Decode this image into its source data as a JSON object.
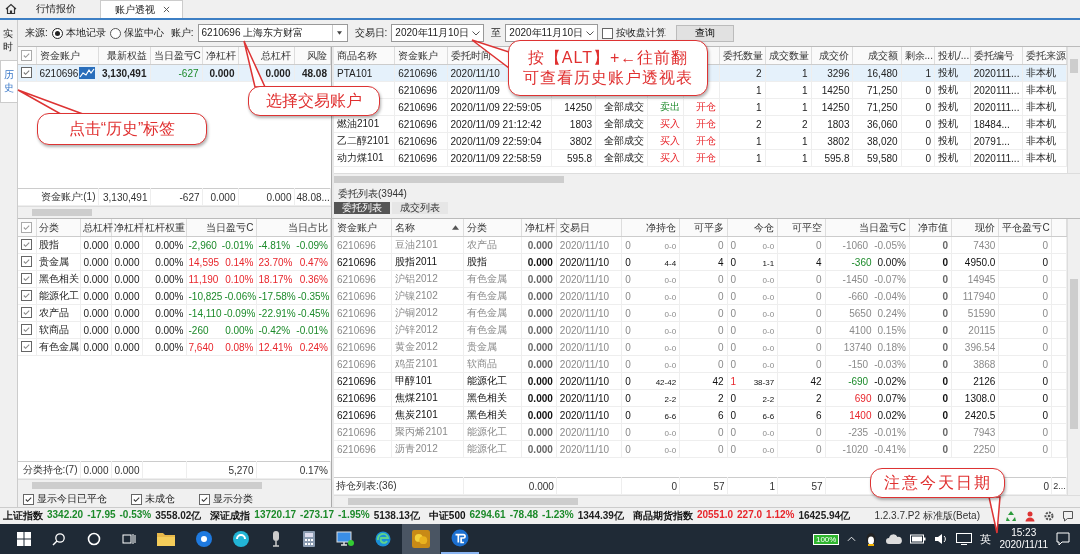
{
  "top_tabs": [
    {
      "label": "行情报价",
      "selected": false,
      "closable": false
    },
    {
      "label": "账户透视",
      "selected": true,
      "closable": true
    }
  ],
  "side_tabs": [
    {
      "label": "实时",
      "selected": false
    },
    {
      "label": "历史",
      "selected": true
    }
  ],
  "filter": {
    "source_label": "来源:",
    "sources": [
      {
        "label": "本地记录",
        "selected": true
      },
      {
        "label": "保监中心",
        "selected": false
      }
    ],
    "account_label": "账户:",
    "account": "6210696 上海东方财富",
    "date_label": "交易日:",
    "date_from": "2020年11月10日",
    "to_label": "至",
    "date_to": "2020年11月10日",
    "close_calc": {
      "label": "按收盘计算",
      "checked": false
    },
    "query_button": "查询"
  },
  "accounts": {
    "header_checked": true,
    "columns": [
      "资金账户",
      "最新权益",
      "当日盈亏C",
      "净杠杆",
      "总杠杆",
      "风险"
    ],
    "rows": [
      {
        "checked": true,
        "selected": true,
        "rising": false,
        "cells": [
          "6210696",
          "3,130,491",
          "-627",
          "0.000",
          "0.000",
          "48.08"
        ]
      }
    ],
    "footer": [
      "资金账户:(1)",
      "3,130,491",
      "-627",
      "0.000",
      "0.000",
      "48.08..."
    ]
  },
  "orders": {
    "columns": [
      "商品名称",
      "资金账户",
      "委托时间",
      null,
      null,
      null,
      null,
      "委托数量",
      "成交数量",
      "成交价",
      "成交额",
      "剩余...",
      "投机/...",
      "委托编号",
      "委托来源"
    ],
    "rows": [
      {
        "selected": true,
        "cells": [
          "PTA101",
          "6210696",
          "2020/11/10",
          null,
          null,
          null,
          null,
          "2",
          "1",
          "3296",
          "16,480",
          "1",
          "投机",
          "2020111...",
          "非本机"
        ]
      },
      {
        "selected": false,
        "cells": [
          null,
          "6210696",
          "2020/11/09",
          null,
          null,
          null,
          null,
          "1",
          "1",
          "14250",
          "71,250",
          "0",
          "投机",
          "2020111...",
          "非本机"
        ]
      },
      {
        "selected": false,
        "sell": true,
        "cells": [
          null,
          "6210696",
          "2020/11/09 22:59:05",
          "14250",
          "全部成交",
          "卖出",
          "开仓",
          "1",
          "1",
          "14250",
          "71,250",
          "0",
          "投机",
          "2020111...",
          "非本机"
        ]
      },
      {
        "selected": false,
        "sell": false,
        "cells": [
          "燃油2101",
          "6210696",
          "2020/11/09 21:12:42",
          "1803",
          "全部成交",
          "买入",
          "开仓",
          "2",
          "2",
          "1803",
          "36,060",
          "0",
          "投机",
          "18484...",
          "非本机"
        ]
      },
      {
        "selected": false,
        "sell": false,
        "cells": [
          "乙二醇2101",
          "6210696",
          "2020/11/09 22:59:04",
          "3802",
          "全部成交",
          "买入",
          "开仓",
          "1",
          "1",
          "3802",
          "38,020",
          "0",
          "投机",
          "20791...",
          "非本机"
        ]
      },
      {
        "selected": false,
        "sell": false,
        "cells": [
          "动力煤101",
          "6210696",
          "2020/11/09 22:58:59",
          "595.8",
          "全部成交",
          "买入",
          "开仓",
          "1",
          "1",
          "595.8",
          "59,580",
          "0",
          "投机",
          "2020111...",
          "非本机"
        ]
      }
    ],
    "list_label": "委托列表(3944)",
    "sub_tabs": [
      {
        "label": "委托列表",
        "selected": true
      },
      {
        "label": "成交列表",
        "selected": false
      }
    ]
  },
  "categories": {
    "header_checked": true,
    "columns": [
      "分类",
      "总杠杆",
      "净杠杆",
      "杠杆权重",
      "当日盈亏C",
      "当日占比"
    ],
    "rows": [
      {
        "checked": true,
        "rising": false,
        "name": "股指",
        "total": "0.000",
        "net": "0.000",
        "weight": "0.00%",
        "pnl": "-2,960",
        "pnl_pct": "-0.01%",
        "share": "-4.81%",
        "share_pct": "-0.09%"
      },
      {
        "checked": true,
        "rising": true,
        "name": "贵金属",
        "total": "0.000",
        "net": "0.000",
        "weight": "0.00%",
        "pnl": "14,595",
        "pnl_pct": "0.14%",
        "share": "23.70%",
        "share_pct": "0.47%"
      },
      {
        "checked": true,
        "rising": true,
        "name": "黑色相关",
        "total": "0.000",
        "net": "0.000",
        "weight": "0.00%",
        "pnl": "11,190",
        "pnl_pct": "0.10%",
        "share": "18.17%",
        "share_pct": "0.36%"
      },
      {
        "checked": true,
        "rising": false,
        "name": "能源化工",
        "total": "0.000",
        "net": "0.000",
        "weight": "0.00%",
        "pnl": "-10,825",
        "pnl_pct": "-0.06%",
        "share": "-17.58%",
        "share_pct": "-0.35%"
      },
      {
        "checked": true,
        "rising": false,
        "name": "农产品",
        "total": "0.000",
        "net": "0.000",
        "weight": "0.00%",
        "pnl": "-14,110",
        "pnl_pct": "-0.09%",
        "share": "-22.91%",
        "share_pct": "-0.45%"
      },
      {
        "checked": true,
        "rising": false,
        "name": "软商品",
        "total": "0.000",
        "net": "0.000",
        "weight": "0.00%",
        "pnl": "-260",
        "pnl_pct": "0.00%",
        "share": "-0.42%",
        "share_pct": "-0.01%"
      },
      {
        "checked": true,
        "rising": true,
        "name": "有色金属",
        "total": "0.000",
        "net": "0.000",
        "weight": "0.00%",
        "pnl": "7,640",
        "pnl_pct": "0.08%",
        "share": "12.41%",
        "share_pct": "0.24%"
      }
    ],
    "footer": {
      "label": "分类持仓:(7)",
      "total": "0.000",
      "net": "0.000",
      "pnl": "5,270",
      "share": "0.17%"
    },
    "options": [
      {
        "label": "显示今日已平仓",
        "checked": true
      },
      {
        "label": "未成仓",
        "checked": true
      },
      {
        "label": "显示分类",
        "checked": true
      }
    ]
  },
  "positions": {
    "columns": [
      {
        "label": "资金账户",
        "sorted": false
      },
      {
        "label": "名称",
        "sorted": true
      },
      {
        "label": "分类",
        "sorted": false
      },
      {
        "label": "净杠杆",
        "sorted": false
      },
      {
        "label": "交易日",
        "sorted": false
      },
      {
        "label": "净持仓",
        "sorted": false
      },
      {
        "label": "可平多",
        "sorted": false
      },
      {
        "label": "今仓",
        "sorted": false
      },
      {
        "label": "可平空",
        "sorted": false
      },
      {
        "label": "当日盈亏C",
        "sorted": false
      },
      {
        "label": "净市值",
        "sorted": false
      },
      {
        "label": "现价",
        "sorted": false
      },
      {
        "label": "平仓盈亏C",
        "sorted": false
      }
    ],
    "rows": [
      {
        "active": false,
        "account": "6210696",
        "name": "豆油2101",
        "category": "农产品",
        "lev": "0.000",
        "date": "2020/11/10",
        "net": [
          "0",
          "0-0"
        ],
        "long": "0",
        "today": [
          "0",
          "0-0"
        ],
        "short": "0",
        "pnl": [
          "-1060",
          "-0.05%"
        ],
        "mv": "0",
        "price": "7430",
        "close_pnl": "0"
      },
      {
        "active": true,
        "rising": false,
        "today_rising": false,
        "account": "6210696",
        "name": "股指2011",
        "category": "股指",
        "lev": "0.000",
        "date": "2020/11/10",
        "net": [
          "0",
          "4-4"
        ],
        "long": "4",
        "today": [
          "0",
          "1-1"
        ],
        "short": "4",
        "pnl": [
          "-360",
          "0.00%"
        ],
        "mv": "0",
        "price": "4950.0",
        "close_pnl": "0"
      },
      {
        "active": false,
        "account": "6210696",
        "name": "沪铝2012",
        "category": "有色金属",
        "lev": "0.000",
        "date": "2020/11/10",
        "net": [
          "0",
          "0-0"
        ],
        "long": "0",
        "today": [
          "0",
          "0-0"
        ],
        "short": "0",
        "pnl": [
          "-1450",
          "-0.07%"
        ],
        "mv": "0",
        "price": "14945",
        "close_pnl": "0"
      },
      {
        "active": false,
        "account": "6210696",
        "name": "沪镍2102",
        "category": "有色金属",
        "lev": "0.000",
        "date": "2020/11/10",
        "net": [
          "0",
          "0-0"
        ],
        "long": "0",
        "today": [
          "0",
          "0-0"
        ],
        "short": "0",
        "pnl": [
          "-660",
          "-0.04%"
        ],
        "mv": "0",
        "price": "117940",
        "close_pnl": "0"
      },
      {
        "active": false,
        "account": "6210696",
        "name": "沪铜2012",
        "category": "有色金属",
        "lev": "0.000",
        "date": "2020/11/10",
        "net": [
          "0",
          "0-0"
        ],
        "long": "0",
        "today": [
          "0",
          "0-0"
        ],
        "short": "0",
        "pnl": [
          "5650",
          "0.24%"
        ],
        "mv": "0",
        "price": "51590",
        "close_pnl": "0"
      },
      {
        "active": false,
        "account": "6210696",
        "name": "沪锌2012",
        "category": "有色金属",
        "lev": "0.000",
        "date": "2020/11/10",
        "net": [
          "0",
          "0-0"
        ],
        "long": "0",
        "today": [
          "0",
          "0-0"
        ],
        "short": "0",
        "pnl": [
          "4100",
          "0.15%"
        ],
        "mv": "0",
        "price": "20115",
        "close_pnl": "0"
      },
      {
        "active": false,
        "account": "6210696",
        "name": "黄金2012",
        "category": "贵金属",
        "lev": "0.000",
        "date": "2020/11/10",
        "net": [
          "0",
          "0-0"
        ],
        "long": "0",
        "today": [
          "0",
          "0-0"
        ],
        "short": "0",
        "pnl": [
          "13740",
          "0.18%"
        ],
        "mv": "0",
        "price": "396.54",
        "close_pnl": "0"
      },
      {
        "active": false,
        "account": "6210696",
        "name": "鸡蛋2101",
        "category": "软商品",
        "lev": "0.000",
        "date": "2020/11/10",
        "net": [
          "0",
          "0-0"
        ],
        "long": "0",
        "today": [
          "0",
          "0-0"
        ],
        "short": "0",
        "pnl": [
          "-150",
          "-0.03%"
        ],
        "mv": "0",
        "price": "3868",
        "close_pnl": "0"
      },
      {
        "active": true,
        "rising": false,
        "today_rising": true,
        "account": "6210696",
        "name": "甲醇101",
        "category": "能源化工",
        "lev": "0.000",
        "date": "2020/11/10",
        "net": [
          "0",
          "42-42"
        ],
        "long": "42",
        "today": [
          "1",
          "38-37"
        ],
        "short": "42",
        "pnl": [
          "-690",
          "-0.02%"
        ],
        "mv": "0",
        "price": "2126",
        "close_pnl": "0"
      },
      {
        "active": true,
        "rising": true,
        "today_rising": false,
        "account": "6210696",
        "name": "焦煤2101",
        "category": "黑色相关",
        "lev": "0.000",
        "date": "2020/11/10",
        "net": [
          "0",
          "2-2"
        ],
        "long": "2",
        "today": [
          "0",
          "2-2"
        ],
        "short": "2",
        "pnl": [
          "690",
          "0.07%"
        ],
        "mv": "0",
        "price": "1308.0",
        "close_pnl": "0"
      },
      {
        "active": true,
        "rising": true,
        "today_rising": false,
        "account": "6210696",
        "name": "焦炭2101",
        "category": "黑色相关",
        "lev": "0.000",
        "date": "2020/11/10",
        "net": [
          "0",
          "6-6"
        ],
        "long": "6",
        "today": [
          "0",
          "6-6"
        ],
        "short": "6",
        "pnl": [
          "1400",
          "0.02%"
        ],
        "mv": "0",
        "price": "2420.5",
        "close_pnl": "0"
      },
      {
        "active": false,
        "account": "6210696",
        "name": "聚丙烯2101",
        "category": "能源化工",
        "lev": "0.000",
        "date": "2020/11/10",
        "net": [
          "0",
          "0-0"
        ],
        "long": "0",
        "today": [
          "0",
          "0-0"
        ],
        "short": "0",
        "pnl": [
          "-235",
          "-0.01%"
        ],
        "mv": "0",
        "price": "7943",
        "close_pnl": "0"
      },
      {
        "active": false,
        "account": "6210696",
        "name": "沥青2012",
        "category": "能源化工",
        "lev": "0.000",
        "date": "2020/11/10",
        "net": [
          "0",
          "0-0"
        ],
        "long": "0",
        "today": [
          "0",
          "0-0"
        ],
        "short": "0",
        "pnl": [
          "-1020",
          "-0.41%"
        ],
        "mv": "0",
        "price": "2250",
        "close_pnl": "0"
      }
    ],
    "footer": {
      "label": "持仓列表:(36)",
      "lev": "0.000",
      "net": "0",
      "long": "57",
      "today": "1",
      "short": "57",
      "close_pnl": "0",
      "extra": "2..."
    }
  },
  "indices": [
    {
      "name": "上证指数",
      "price": "3342.20",
      "change": "-17.95",
      "pct": "-0.53%",
      "volume": "3558.02亿",
      "rising": false
    },
    {
      "name": "深证成指",
      "price": "13720.17",
      "change": "-273.17",
      "pct": "-1.95%",
      "volume": "5138.13亿",
      "rising": false
    },
    {
      "name": "中证500",
      "price": "6294.61",
      "change": "-78.48",
      "pct": "-1.23%",
      "volume": "1344.39亿",
      "rising": false
    },
    {
      "name": "商品期货指数",
      "price": "20551.0",
      "change": "227.0",
      "pct": "1.12%",
      "volume": "16425.94亿",
      "rising": true
    }
  ],
  "version": "1.2.3.7.P2 标准版(Beta)",
  "tray": {
    "battery": "100%",
    "ime": "英",
    "time": "15:23",
    "date": "2020/11/11"
  },
  "callouts": [
    {
      "lines": [
        "点击“历史”标签"
      ]
    },
    {
      "lines": [
        "选择交易账户"
      ]
    },
    {
      "lines": [
        "按【ALT】+←往前翻",
        "可查看历史账户透视表"
      ]
    },
    {
      "lines": [
        "注意今天日期"
      ]
    }
  ]
}
